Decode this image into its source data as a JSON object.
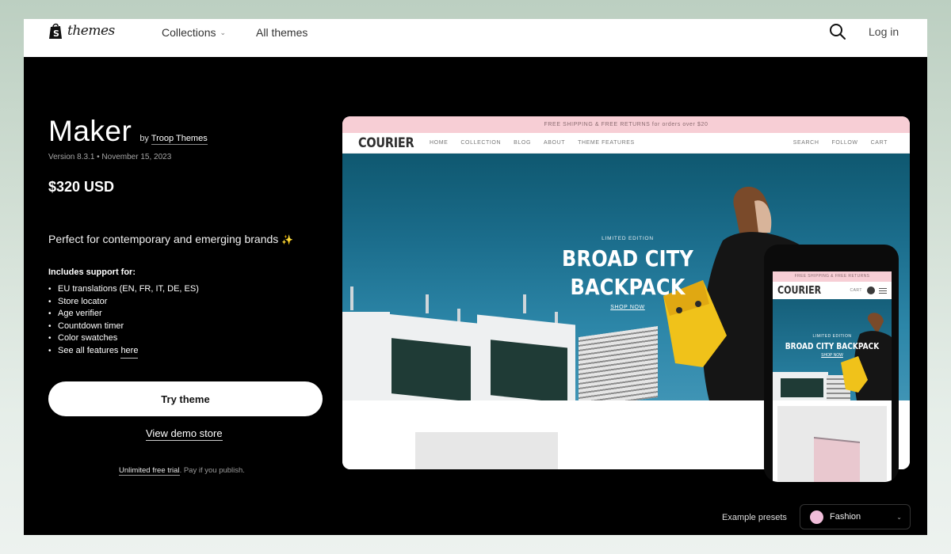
{
  "header": {
    "logo_text": "themes",
    "nav": {
      "collections": "Collections",
      "all_themes": "All themes"
    },
    "login": "Log in"
  },
  "theme": {
    "name": "Maker",
    "by_prefix": "by",
    "author": "Troop Themes",
    "version_line": "Version 8.3.1 • November 15, 2023",
    "price": "$320 USD",
    "tagline": "Perfect for contemporary and emerging brands",
    "tagline_emoji": "✨",
    "support_heading": "Includes support for:",
    "features": [
      "EU translations (EN, FR, IT, DE, ES)",
      "Store locator",
      "Age verifier",
      "Countdown timer",
      "Color swatches"
    ],
    "see_all_prefix": "See all features",
    "see_all_link": "here",
    "try_button": "Try theme",
    "demo_link": "View demo store",
    "trial_link": "Unlimited free trial",
    "trial_suffix": ". Pay if you publish."
  },
  "preview": {
    "announcement": "FREE SHIPPING & FREE RETURNS for orders over $20",
    "brand": "COURIER",
    "nav_links": [
      "HOME",
      "COLLECTION",
      "BLOG",
      "ABOUT",
      "THEME FEATURES"
    ],
    "nav_right": [
      "SEARCH",
      "FOLLOW",
      "CART"
    ],
    "hero_small": "LIMITED EDITION",
    "hero_line1": "BROAD CITY",
    "hero_line2": "BACKPACK",
    "hero_cta": "SHOP NOW"
  },
  "mobile_preview": {
    "announcement": "FREE SHIPPING & FREE RETURNS",
    "brand": "COURIER",
    "cart": "CART",
    "cart_count": "0",
    "hero_small": "LIMITED EDITION",
    "hero_big": "BROAD CITY BACKPACK",
    "hero_cta": "SHOP NOW"
  },
  "presets": {
    "label": "Example presets",
    "selected": "Fashion",
    "selected_color": "#f0bdd9"
  }
}
